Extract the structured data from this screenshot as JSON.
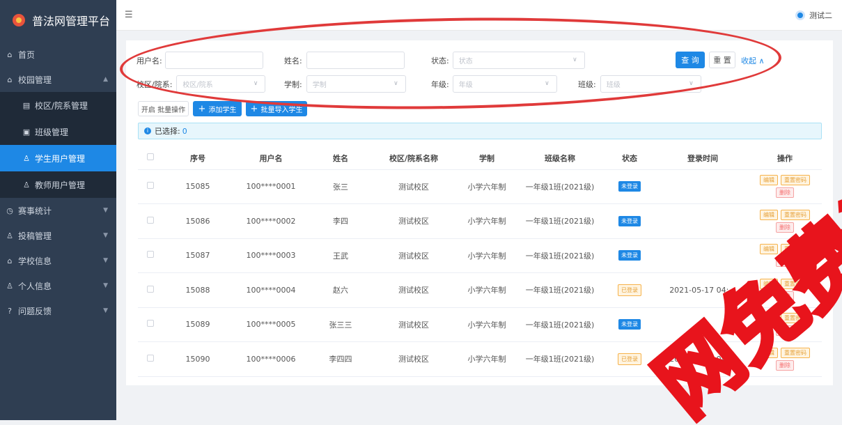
{
  "app": {
    "title": "普法网管理平台"
  },
  "header": {
    "user_name": "测试二"
  },
  "sidebar": {
    "items": [
      {
        "label": "首页",
        "icon": "home-icon"
      },
      {
        "label": "校园管理",
        "icon": "school-icon",
        "expanded": true,
        "children": [
          {
            "label": "校区/院系管理",
            "icon": "document-icon"
          },
          {
            "label": "班级管理",
            "icon": "class-icon"
          },
          {
            "label": "学生用户管理",
            "icon": "user-icon",
            "active": true
          },
          {
            "label": "教师用户管理",
            "icon": "user-icon"
          }
        ]
      },
      {
        "label": "赛事统计",
        "icon": "clock-icon"
      },
      {
        "label": "投稿管理",
        "icon": "user-icon"
      },
      {
        "label": "学校信息",
        "icon": "bank-icon"
      },
      {
        "label": "个人信息",
        "icon": "person-icon"
      },
      {
        "label": "问题反馈",
        "icon": "help-icon"
      }
    ]
  },
  "filters": {
    "username_label": "用户名:",
    "username_value": "",
    "name_label": "姓名:",
    "name_value": "",
    "status_label": "状态:",
    "status_placeholder": "状态",
    "query_label": "查 询",
    "reset_label": "重 置",
    "collapse_label": "收起 ∧",
    "campus_label": "校区/院系:",
    "campus_placeholder": "校区/院系",
    "system_label": "学制:",
    "system_placeholder": "学制",
    "grade_label": "年级:",
    "grade_placeholder": "年级",
    "class_label": "班级:",
    "class_placeholder": "班级"
  },
  "actions": {
    "batch_label": "开启 批量操作",
    "add_label": "添加学生",
    "import_label": "批量导入学生"
  },
  "selection": {
    "label": "已选择:",
    "count": "0"
  },
  "table": {
    "columns": [
      "序号",
      "用户名",
      "姓名",
      "校区/院系名称",
      "学制",
      "班级名称",
      "状态",
      "登录时间",
      "操作"
    ],
    "rows": [
      {
        "id": "15085",
        "username": "100****0001",
        "name": "张三",
        "campus": "测试校区",
        "system": "小学六年制",
        "class": "一年级1班(2021级)",
        "status": "未登录",
        "login_time": ""
      },
      {
        "id": "15086",
        "username": "100****0002",
        "name": "李四",
        "campus": "测试校区",
        "system": "小学六年制",
        "class": "一年级1班(2021级)",
        "status": "未登录",
        "login_time": ""
      },
      {
        "id": "15087",
        "username": "100****0003",
        "name": "王武",
        "campus": "测试校区",
        "system": "小学六年制",
        "class": "一年级1班(2021级)",
        "status": "未登录",
        "login_time": ""
      },
      {
        "id": "15088",
        "username": "100****0004",
        "name": "赵六",
        "campus": "测试校区",
        "system": "小学六年制",
        "class": "一年级1班(2021级)",
        "status": "已登录",
        "login_time": "2021-05-17 04:..."
      },
      {
        "id": "15089",
        "username": "100****0005",
        "name": "张三三",
        "campus": "测试校区",
        "system": "小学六年制",
        "class": "一年级1班(2021级)",
        "status": "未登录",
        "login_time": ""
      },
      {
        "id": "15090",
        "username": "100****0006",
        "name": "李四四",
        "campus": "测试校区",
        "system": "小学六年制",
        "class": "一年级1班(2021级)",
        "status": "已登录",
        "login_time": "2021-05-17 04:..."
      }
    ],
    "op_edit": "编辑",
    "op_reset": "重置密码",
    "op_delete": "删除"
  },
  "watermark": {
    "text": "网免费资"
  },
  "colors": {
    "primary": "#1e88e5",
    "sidebar_bg": "#2f3e52",
    "annotation": "#e03a3a",
    "warning": "#e6a23c",
    "danger": "#f56c6c"
  }
}
